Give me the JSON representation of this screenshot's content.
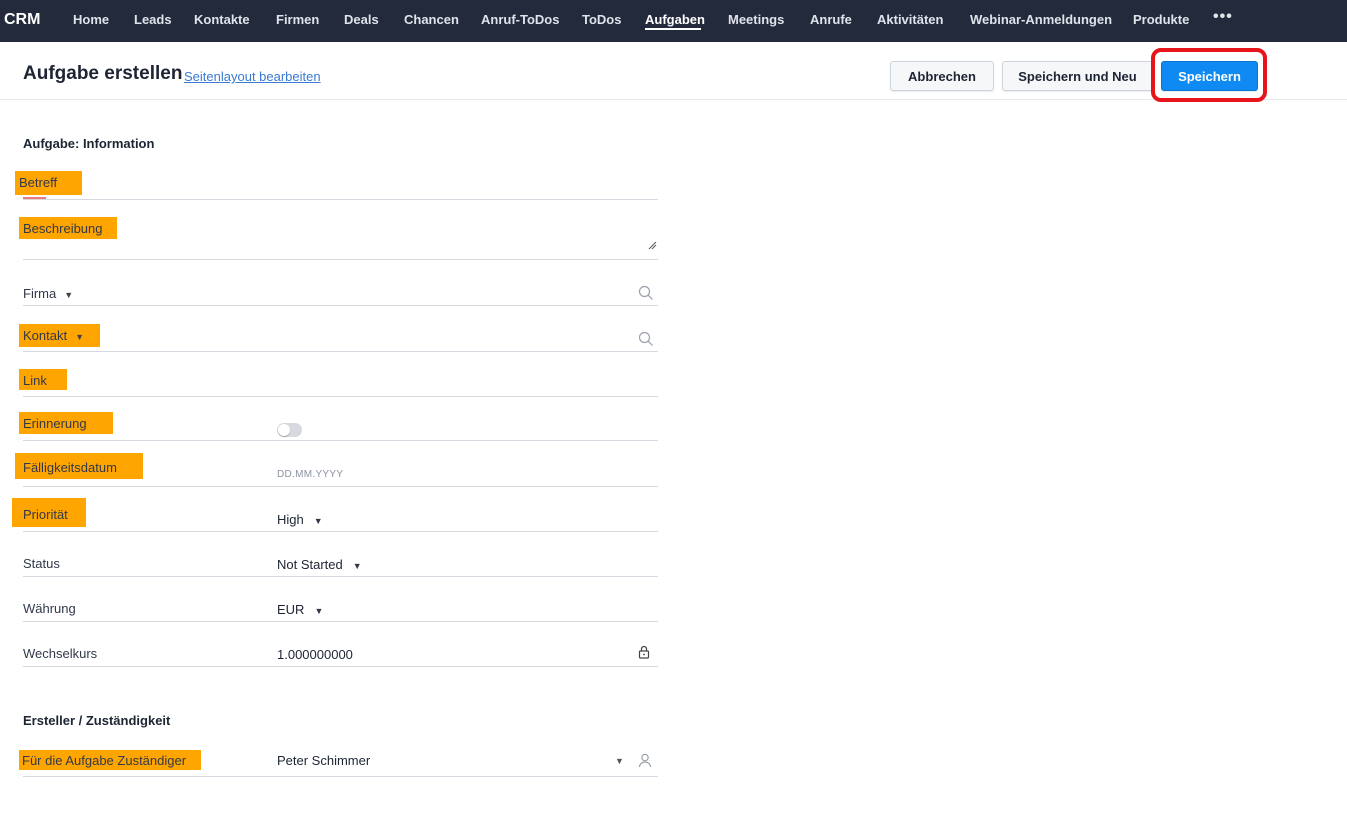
{
  "nav": {
    "brand": "CRM",
    "items": [
      "Home",
      "Leads",
      "Kontakte",
      "Firmen",
      "Deals",
      "Chancen",
      "Anruf-ToDos",
      "ToDos",
      "Aufgaben",
      "Meetings",
      "Anrufe",
      "Aktivitäten",
      "Webinar-Anmeldungen",
      "Produkte"
    ],
    "active": "Aufgaben",
    "more": "•••"
  },
  "header": {
    "title": "Aufgabe erstellen",
    "layout_link": "Seitenlayout bearbeiten",
    "cancel_label": "Abbrechen",
    "save_new_label": "Speichern und Neu",
    "save_label": "Speichern"
  },
  "sections": {
    "info_title": "Aufgabe: Information",
    "owner_title": "Ersteller / Zuständigkeit"
  },
  "fields": {
    "subject": {
      "label": "Betreff",
      "value": ""
    },
    "description": {
      "label": "Beschreibung",
      "value": ""
    },
    "company": {
      "label": "Firma",
      "value": ""
    },
    "contact": {
      "label": "Kontakt",
      "value": ""
    },
    "link": {
      "label": "Link",
      "value": ""
    },
    "reminder": {
      "label": "Erinnerung",
      "enabled": false
    },
    "due_date": {
      "label": "Fälligkeitsdatum",
      "placeholder": "DD.MM.YYYY"
    },
    "priority": {
      "label": "Priorität",
      "value": "High"
    },
    "status": {
      "label": "Status",
      "value": "Not Started"
    },
    "currency": {
      "label": "Währung",
      "value": "EUR"
    },
    "exchange_rate": {
      "label": "Wechselkurs",
      "value": "1.000000000"
    },
    "owner": {
      "label": "Für die Aufgabe Zuständiger",
      "value": "Peter Schimmer"
    }
  },
  "colors": {
    "nav_bg": "#232a3b",
    "highlight_label": "#ffa500",
    "primary_button": "#0e8af2",
    "callout_ring": "#e8141c"
  },
  "icons": [
    "search-icon",
    "lock-icon",
    "user-icon",
    "chevron-down-icon",
    "resize-handle-icon"
  ]
}
